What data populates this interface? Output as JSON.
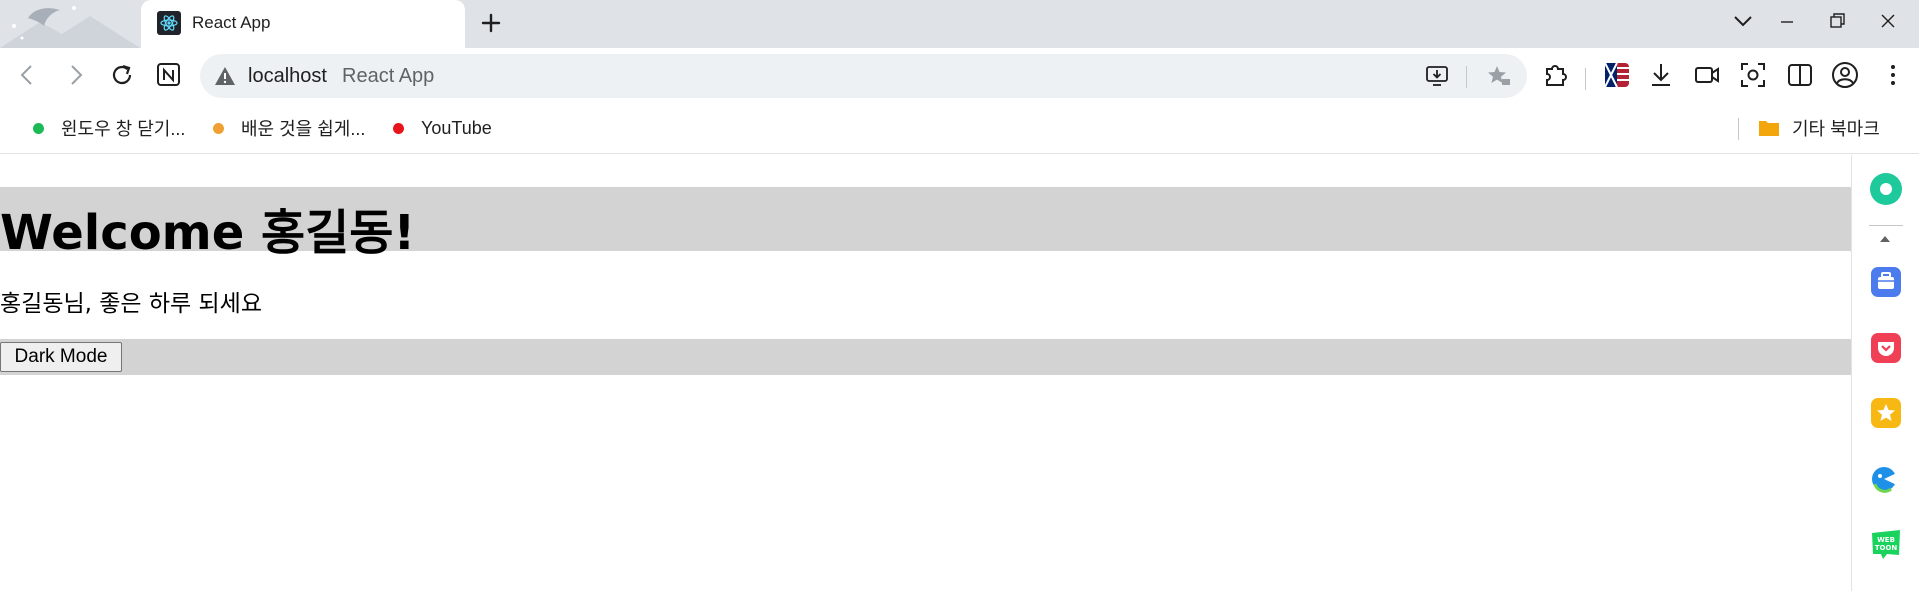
{
  "browser": {
    "tab": {
      "title": "React App"
    },
    "omnibox": {
      "host": "localhost",
      "page_title": "React App"
    },
    "bookmarks": [
      {
        "label": "윈도우 창 닫기...",
        "color": "#1db954"
      },
      {
        "label": "배운 것을 쉽게...",
        "color": "#f0a030"
      },
      {
        "label": "YouTube",
        "color": "#e8141b"
      }
    ],
    "other_bookmarks": {
      "label": "기타 북마크"
    }
  },
  "app": {
    "title": "Welcome 홍길동!",
    "greeting": "홍길동님, 좋은 하루 되세요",
    "dark_mode_button": "Dark Mode",
    "band_color": "#d3d3d3"
  },
  "side_panel": {
    "icons": [
      "circle-app-icon",
      "briefcase-icon",
      "pocket-icon",
      "star-icon",
      "bird-icon",
      "webtoon-icon"
    ]
  }
}
